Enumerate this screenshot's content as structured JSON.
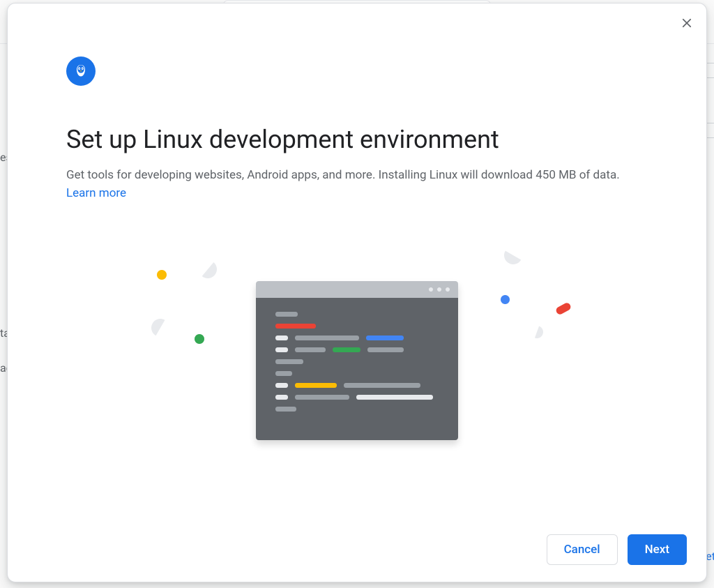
{
  "dialog": {
    "title": "Set up Linux development environment",
    "subtitle": "Get tools for developing websites, Android apps, and more. Installing Linux will download 450 MB of data.",
    "learn_more": "Learn more",
    "buttons": {
      "cancel": "Cancel",
      "next": "Next"
    },
    "icons": {
      "close": "close-icon",
      "logo": "penguin-icon"
    }
  }
}
